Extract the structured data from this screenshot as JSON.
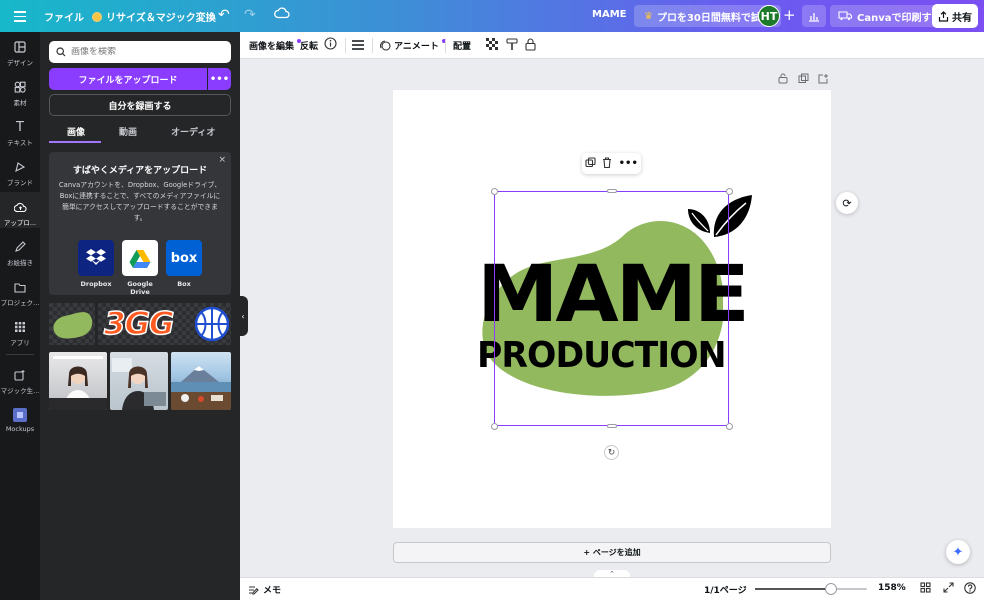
{
  "topbar": {
    "file_label": "ファイル",
    "resize_label": "リサイズ＆マジック変換",
    "doc_title": "MAME",
    "pro_trial_label": "プロを30日間無料で試す",
    "avatar_initials": "HT",
    "print_label": "Canvaで印刷する",
    "share_label": "共有"
  },
  "rail": {
    "items": [
      {
        "label": "デザイン",
        "icon": "layout-icon"
      },
      {
        "label": "素材",
        "icon": "shapes-icon"
      },
      {
        "label": "テキスト",
        "icon": "text-icon"
      },
      {
        "label": "ブランド",
        "icon": "brand-icon"
      },
      {
        "label": "アップロ...",
        "icon": "upload-cloud-icon"
      },
      {
        "label": "お絵描き",
        "icon": "draw-icon"
      },
      {
        "label": "プロジェク...",
        "icon": "folder-icon"
      },
      {
        "label": "アプリ",
        "icon": "apps-icon"
      },
      {
        "label": "マジック生...",
        "icon": "magic-media-icon"
      },
      {
        "label": "Mockups",
        "icon": "mockups-icon"
      }
    ]
  },
  "panel": {
    "search_placeholder": "画像を検索",
    "upload_label": "ファイルをアップロード",
    "more_label": "•••",
    "record_label": "自分を録画する",
    "tabs": [
      {
        "label": "画像"
      },
      {
        "label": "動画"
      },
      {
        "label": "オーディオ"
      }
    ],
    "promo": {
      "close": "×",
      "title": "すばやくメディアをアップロード",
      "description": "Canvaアカウントを、Dropbox、Googleドライブ、Boxに連携することで、すべてのメディアファイルに簡単にアクセスしてアップロードすることができます。",
      "services": [
        {
          "label": "Dropbox",
          "color": "#0d2481"
        },
        {
          "label": "Google Drive",
          "color": "#ffffff"
        },
        {
          "label": "Box",
          "color": "#0061d5"
        }
      ],
      "box_logo_text": "box"
    }
  },
  "context_toolbar": {
    "edit_image": "画像を編集",
    "flip": "反転",
    "animate": "アニメート",
    "position": "配置"
  },
  "canvas": {
    "logo_line1": "MAME",
    "logo_line2": "PRODUCTION",
    "add_page_label": "+ ページを追加",
    "colors": {
      "blob": "#93b95f",
      "selection": "#8b3dff"
    }
  },
  "bottombar": {
    "notes_label": "メモ",
    "pages_label": "1/1ページ",
    "zoom_label": "158%",
    "zoom_fraction": 0.68
  },
  "thumbnails": {
    "brand_text": "3GG"
  }
}
